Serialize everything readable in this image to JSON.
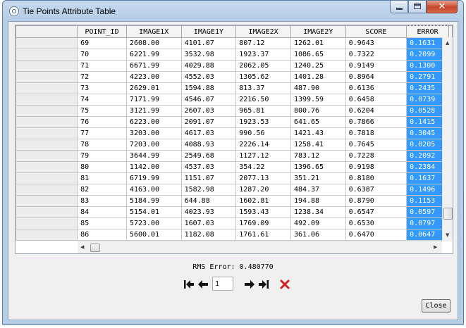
{
  "window": {
    "title": "Tie Points Attribute Table",
    "controls": {
      "minimize": "—",
      "maximize": "□",
      "close": "✕"
    }
  },
  "table": {
    "columns": [
      "POINT_ID",
      "IMAGE1X",
      "IMAGE1Y",
      "IMAGE2X",
      "IMAGE2Y",
      "SCORE",
      "ERROR"
    ],
    "rows": [
      [
        "69",
        "2608.00",
        "4101.07",
        "807.12",
        "1262.01",
        "0.9643",
        "0.1631"
      ],
      [
        "70",
        "6221.99",
        "3532.98",
        "1923.37",
        "1086.65",
        "0.7322",
        "0.2099"
      ],
      [
        "71",
        "6671.99",
        "4029.88",
        "2062.05",
        "1240.25",
        "0.9149",
        "0.1300"
      ],
      [
        "72",
        "4223.00",
        "4552.03",
        "1305.62",
        "1401.28",
        "0.8964",
        "0.2791"
      ],
      [
        "73",
        "2629.01",
        "1594.88",
        "813.37",
        "487.90",
        "0.6136",
        "0.2435"
      ],
      [
        "74",
        "7171.99",
        "4546.07",
        "2216.50",
        "1399.59",
        "0.6458",
        "0.0739"
      ],
      [
        "75",
        "3121.99",
        "2607.03",
        "965.81",
        "800.76",
        "0.6204",
        "0.0528"
      ],
      [
        "76",
        "6223.00",
        "2091.07",
        "1923.53",
        "641.65",
        "0.7866",
        "0.1415"
      ],
      [
        "77",
        "3203.00",
        "4617.03",
        "990.56",
        "1421.43",
        "0.7818",
        "0.3045"
      ],
      [
        "78",
        "7203.00",
        "4088.93",
        "2226.14",
        "1258.41",
        "0.7645",
        "0.0205"
      ],
      [
        "79",
        "3644.99",
        "2549.68",
        "1127.12",
        "783.12",
        "0.7228",
        "0.2092"
      ],
      [
        "80",
        "1142.00",
        "4537.03",
        "354.22",
        "1396.65",
        "0.9198",
        "0.2384"
      ],
      [
        "81",
        "6719.99",
        "1151.07",
        "2077.13",
        "351.21",
        "0.8180",
        "0.1637"
      ],
      [
        "82",
        "4163.00",
        "1582.98",
        "1287.20",
        "484.37",
        "0.6387",
        "0.1496"
      ],
      [
        "83",
        "5184.99",
        "644.88",
        "1602.81",
        "194.88",
        "0.8790",
        "0.1153"
      ],
      [
        "84",
        "5154.01",
        "4023.93",
        "1593.43",
        "1238.34",
        "0.6547",
        "0.0597"
      ],
      [
        "85",
        "5723.00",
        "1607.03",
        "1769.09",
        "492.09",
        "0.6530",
        "0.0797"
      ],
      [
        "86",
        "5600.01",
        "1182.08",
        "1761.61",
        "361.06",
        "0.6470",
        "0.0647"
      ]
    ]
  },
  "rms": {
    "text": "RMS Error: 0.480770"
  },
  "pager": {
    "page": "1"
  },
  "buttons": {
    "close": "Close"
  },
  "colors": {
    "selection": "#3399ff",
    "delete_icon": "#d02020"
  },
  "icons": [
    "first-page-icon",
    "previous-page-icon",
    "next-page-icon",
    "last-page-icon",
    "delete-icon"
  ]
}
